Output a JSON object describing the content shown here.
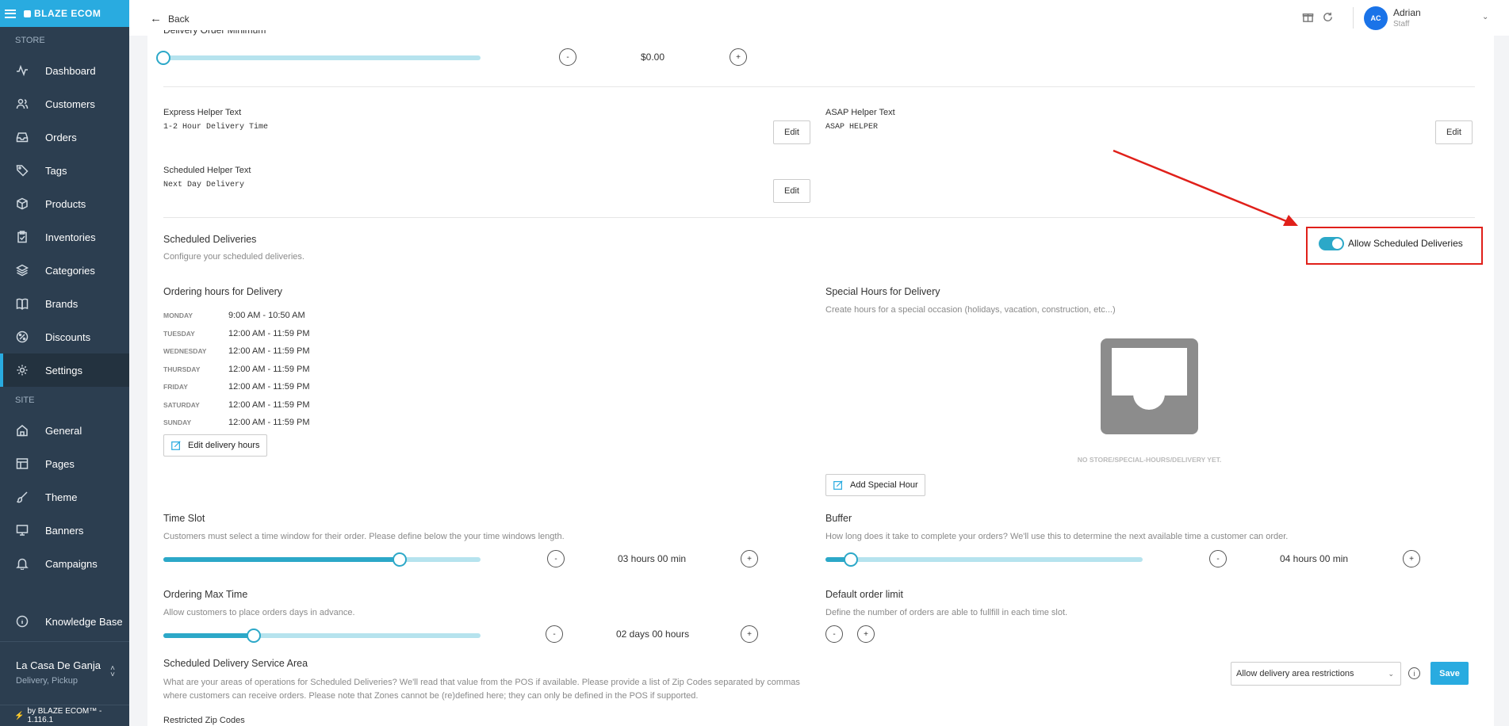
{
  "sidebar": {
    "brand": "BLAZE ECOM",
    "store_section": "STORE",
    "store_items": [
      {
        "label": "Dashboard",
        "icon": "activity-icon"
      },
      {
        "label": "Customers",
        "icon": "users-icon"
      },
      {
        "label": "Orders",
        "icon": "inbox-icon"
      },
      {
        "label": "Tags",
        "icon": "tag-icon"
      },
      {
        "label": "Products",
        "icon": "box-icon"
      },
      {
        "label": "Inventories",
        "icon": "clipboard-icon"
      },
      {
        "label": "Categories",
        "icon": "layers-icon"
      },
      {
        "label": "Brands",
        "icon": "book-icon"
      },
      {
        "label": "Discounts",
        "icon": "percent-icon"
      },
      {
        "label": "Settings",
        "icon": "gear-icon"
      }
    ],
    "site_section": "SITE",
    "site_items": [
      {
        "label": "General",
        "icon": "home-icon"
      },
      {
        "label": "Pages",
        "icon": "layout-icon"
      },
      {
        "label": "Theme",
        "icon": "brush-icon"
      },
      {
        "label": "Banners",
        "icon": "monitor-icon"
      },
      {
        "label": "Campaigns",
        "icon": "bell-icon"
      }
    ],
    "knowledge_base": "Knowledge Base",
    "store_name": "La Casa De Ganja",
    "store_sub": "Delivery, Pickup",
    "footer": "by BLAZE ECOM™ - 1.116.1"
  },
  "header": {
    "back": "Back",
    "avatar_initials": "AC",
    "user_name": "Adrian",
    "user_role": "Staff"
  },
  "delivery_min": {
    "label": "Delivery Order Minimum",
    "value": "$0.00",
    "level": 0
  },
  "helpers": {
    "express_label": "Express Helper Text",
    "express_value": "1-2 Hour Delivery Time",
    "asap_label": "ASAP Helper Text",
    "asap_value": "ASAP HELPER",
    "scheduled_label": "Scheduled Helper Text",
    "scheduled_value": "Next Day Delivery",
    "edit": "Edit"
  },
  "scheduled": {
    "title": "Scheduled Deliveries",
    "subtitle": "Configure your scheduled deliveries.",
    "toggle_label": "Allow Scheduled Deliveries",
    "toggle_on": true
  },
  "ordering_hours": {
    "title": "Ordering hours for Delivery",
    "days": [
      {
        "day": "MONDAY",
        "hours": "9:00 AM - 10:50 AM"
      },
      {
        "day": "TUESDAY",
        "hours": "12:00 AM - 11:59 PM"
      },
      {
        "day": "WEDNESDAY",
        "hours": "12:00 AM - 11:59 PM"
      },
      {
        "day": "THURSDAY",
        "hours": "12:00 AM - 11:59 PM"
      },
      {
        "day": "FRIDAY",
        "hours": "12:00 AM - 11:59 PM"
      },
      {
        "day": "SATURDAY",
        "hours": "12:00 AM - 11:59 PM"
      },
      {
        "day": "SUNDAY",
        "hours": "12:00 AM - 11:59 PM"
      }
    ],
    "edit_button": "Edit delivery hours"
  },
  "special_hours": {
    "title": "Special Hours for Delivery",
    "subtitle": "Create hours for a special occasion (holidays, vacation, construction, etc...)",
    "empty": "NO STORE/SPECIAL-HOURS/DELIVERY YET.",
    "add_button": "Add Special Hour"
  },
  "time_slot": {
    "title": "Time Slot",
    "subtitle": "Customers must select a time window for their order. Please define below the your time windows length.",
    "value": "03 hours 00 min",
    "level": 0.745
  },
  "buffer": {
    "title": "Buffer",
    "subtitle": "How long does it take to complete your orders? We'll use this to determine the next available time a customer can order.",
    "value": "04 hours 00 min",
    "level": 0.08
  },
  "max_time": {
    "title": "Ordering Max Time",
    "subtitle": "Allow customers to place orders days in advance.",
    "value": "02 days 00 hours",
    "level": 0.285
  },
  "order_limit": {
    "title": "Default order limit",
    "subtitle": "Define the number of orders are able to fullfill in each time slot."
  },
  "service_area": {
    "title": "Scheduled Delivery Service Area",
    "subtitle": "What are your areas of operations for Scheduled Deliveries? We'll read that value from the POS if available. Please provide a list of Zip Codes separated by commas where customers can receive orders. Please note that Zones cannot be (re)defined here; they can only be defined in the POS if supported.",
    "select_value": "Allow delivery area restrictions",
    "save": "Save",
    "restricted_label": "Restricted Zip Codes"
  },
  "controls": {
    "minus": "-",
    "plus": "+",
    "info": "i"
  },
  "colors": {
    "accent": "#29abe0",
    "sidebar": "#2c3e50",
    "highlight": "#e0201a"
  }
}
